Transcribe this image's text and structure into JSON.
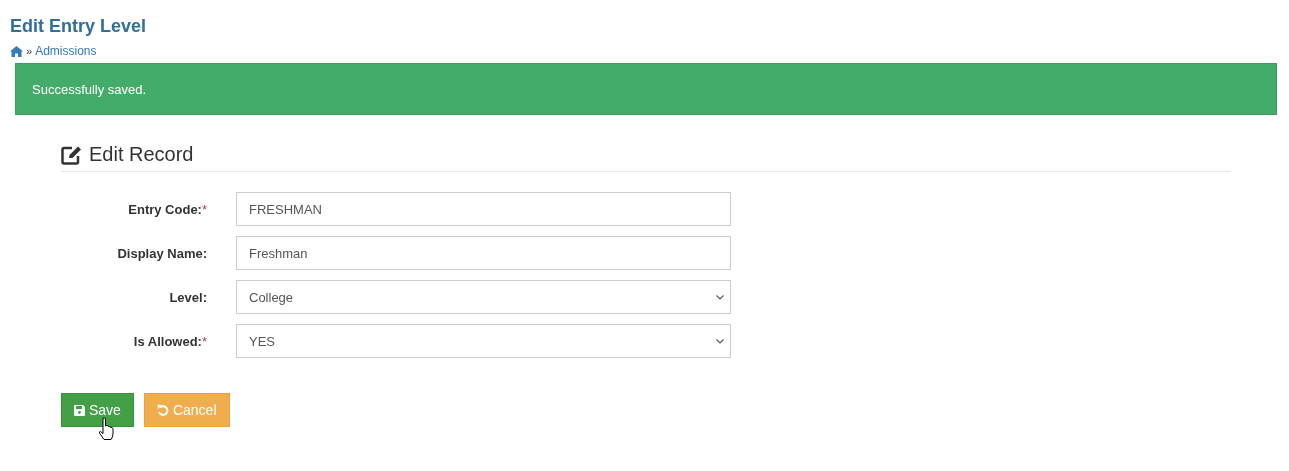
{
  "page": {
    "title": "Edit Entry Level"
  },
  "breadcrumb": {
    "separator": "»",
    "link": "Admissions"
  },
  "alert": {
    "message": "Successfully saved."
  },
  "panel": {
    "title": "Edit Record"
  },
  "fields": [
    {
      "kind": "text",
      "label": "Entry Code:",
      "required_mark": "*",
      "value": "FRESHMAN"
    },
    {
      "kind": "text",
      "label": "Display Name:",
      "value": "Freshman"
    },
    {
      "kind": "select",
      "label": "Level:",
      "value": "College"
    },
    {
      "kind": "select",
      "label": "Is Allowed:",
      "required_mark": "*",
      "value": "YES"
    }
  ],
  "buttons": [
    {
      "kind": "save",
      "label": "Save"
    },
    {
      "kind": "cancel",
      "label": "Cancel"
    }
  ]
}
